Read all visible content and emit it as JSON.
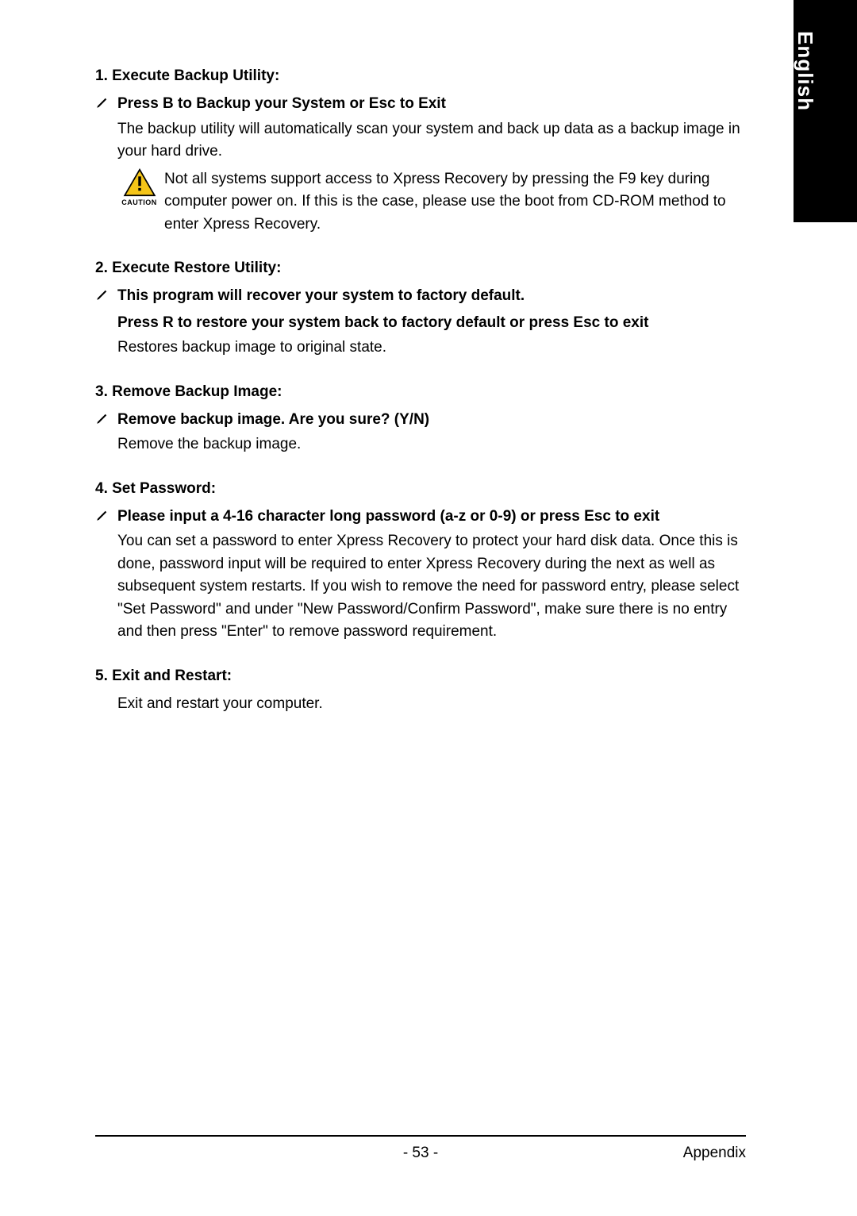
{
  "sidebar": {
    "language": "English"
  },
  "sections": {
    "s1": {
      "heading": "1. Execute Backup Utility:",
      "bold": "Press B to Backup your System or Esc to Exit",
      "body": "The backup utility will automatically scan your system and back up data as a backup image in your hard drive.",
      "caution_label": "CAUTION",
      "caution_text": "Not all systems support access to Xpress Recovery by pressing the F9 key during computer power on. If this is the case, please use the boot from CD-ROM method to enter Xpress Recovery."
    },
    "s2": {
      "heading": "2. Execute Restore Utility:",
      "bold1": "This program will recover your system to factory default.",
      "bold2": "Press R to restore your system back to factory default or press Esc to exit",
      "body": "Restores backup image to original state."
    },
    "s3": {
      "heading": "3. Remove Backup Image:",
      "bold": "Remove backup image.  Are you sure?  (Y/N)",
      "body": "Remove the backup image."
    },
    "s4": {
      "heading": "4. Set Password:",
      "bold": "Please input a 4-16 character long password (a-z or 0-9) or press Esc to exit",
      "body": "You can set a password to enter Xpress Recovery to protect your hard disk data.  Once this is done, password input will be required to enter Xpress Recovery during the next as well as subsequent system restarts.  If you wish to remove the need for password entry, please select \"Set Password\" and under \"New Password/Confirm Password\", make sure there is no entry and then press \"Enter\" to remove password requirement."
    },
    "s5": {
      "heading": "5. Exit and Restart:",
      "body": "Exit and restart your computer."
    }
  },
  "footer": {
    "page_number": "- 53 -",
    "section": "Appendix"
  }
}
